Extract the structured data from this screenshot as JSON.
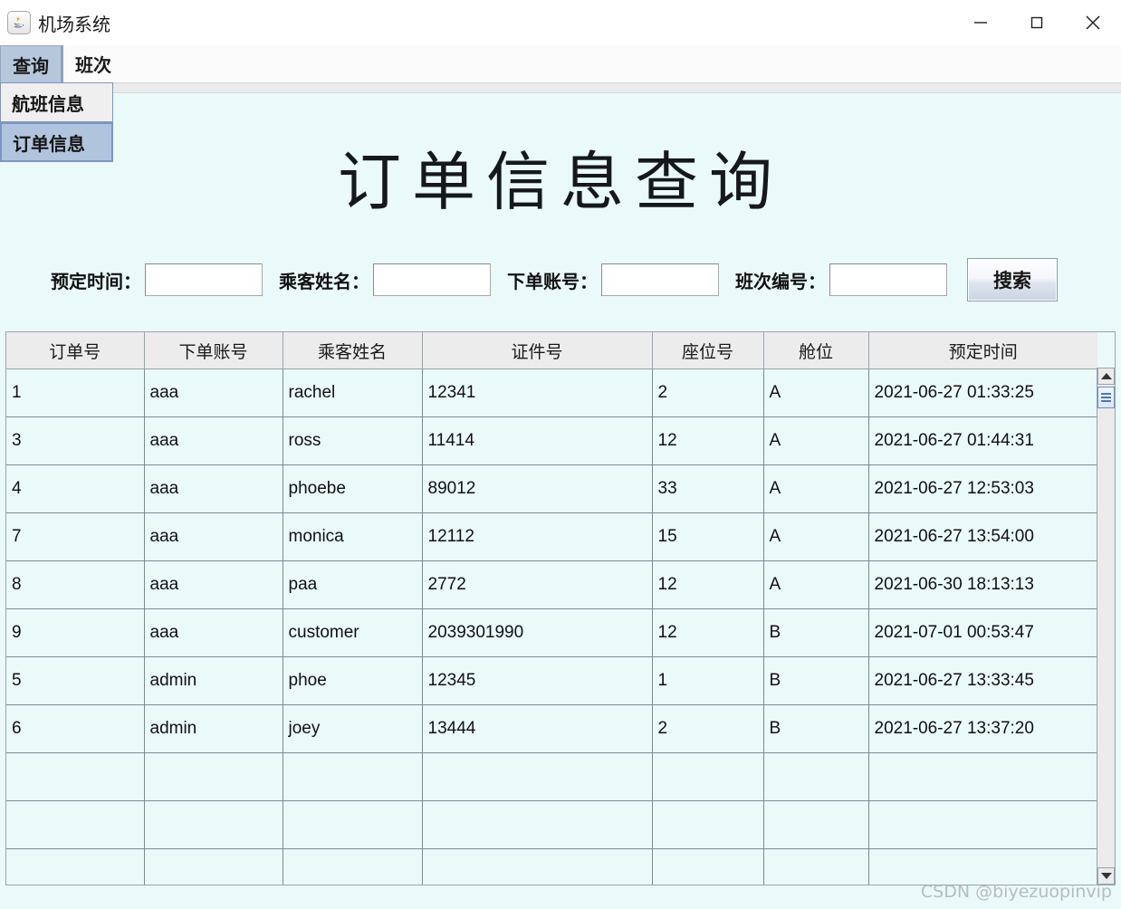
{
  "window": {
    "title": "机场系统",
    "icon": "java-icon",
    "controls": [
      {
        "name": "minimize",
        "glyph": "—"
      },
      {
        "name": "maximize",
        "glyph": "□"
      },
      {
        "name": "close",
        "glyph": "✕"
      }
    ]
  },
  "menubar": {
    "items": [
      {
        "label": "查询",
        "selected": true
      },
      {
        "label": "班次",
        "selected": false
      }
    ]
  },
  "dropdown": {
    "open": true,
    "items": [
      {
        "label": "航班信息",
        "active": false
      },
      {
        "label": "订单信息",
        "active": true
      }
    ]
  },
  "page": {
    "title": "订单信息查询"
  },
  "search": {
    "fields": [
      {
        "label": "预定时间：",
        "value": "",
        "placeholder": ""
      },
      {
        "label": "乘客姓名：",
        "value": "",
        "placeholder": ""
      },
      {
        "label": "下单账号：",
        "value": "",
        "placeholder": ""
      },
      {
        "label": "班次编号：",
        "value": "",
        "placeholder": ""
      }
    ],
    "button_label": "搜索"
  },
  "table": {
    "columns": [
      "订单号",
      "下单账号",
      "乘客姓名",
      "证件号",
      "座位号",
      "舱位",
      "预定时间"
    ],
    "rows": [
      [
        "1",
        "aaa",
        "rachel",
        "12341",
        "2",
        "A",
        "2021-06-27 01:33:25"
      ],
      [
        "3",
        "aaa",
        "ross",
        "11414",
        "12",
        "A",
        "2021-06-27 01:44:31"
      ],
      [
        "4",
        "aaa",
        "phoebe",
        "89012",
        "33",
        "A",
        "2021-06-27 12:53:03"
      ],
      [
        "7",
        "aaa",
        "monica",
        "12112",
        "15",
        "A",
        "2021-06-27 13:54:00"
      ],
      [
        "8",
        "aaa",
        "paa",
        "2772",
        "12",
        "A",
        "2021-06-30 18:13:13"
      ],
      [
        "9",
        "aaa",
        "customer",
        "2039301990",
        "12",
        "B",
        "2021-07-01 00:53:47"
      ],
      [
        "5",
        "admin",
        "phoe",
        "12345",
        "1",
        "B",
        "2021-06-27 13:33:45"
      ],
      [
        "6",
        "admin",
        "joey",
        "13444",
        "2",
        "B",
        "2021-06-27 13:37:20"
      ],
      [
        "",
        "",
        "",
        "",
        "",
        "",
        ""
      ],
      [
        "",
        "",
        "",
        "",
        "",
        "",
        ""
      ],
      [
        "",
        "",
        "",
        "",
        "",
        "",
        ""
      ]
    ]
  },
  "scrollbar": {
    "orientation": "vertical",
    "up_arrow": "scroll-up",
    "down_arrow": "scroll-down"
  },
  "watermark": {
    "text": "CSDN @biyezuopinvip"
  },
  "colors": {
    "panel_bg": "#eafaf9",
    "header_bg": "#ececec",
    "selected_menu": "#b6c7dc",
    "grid_line": "#7b8b96"
  }
}
